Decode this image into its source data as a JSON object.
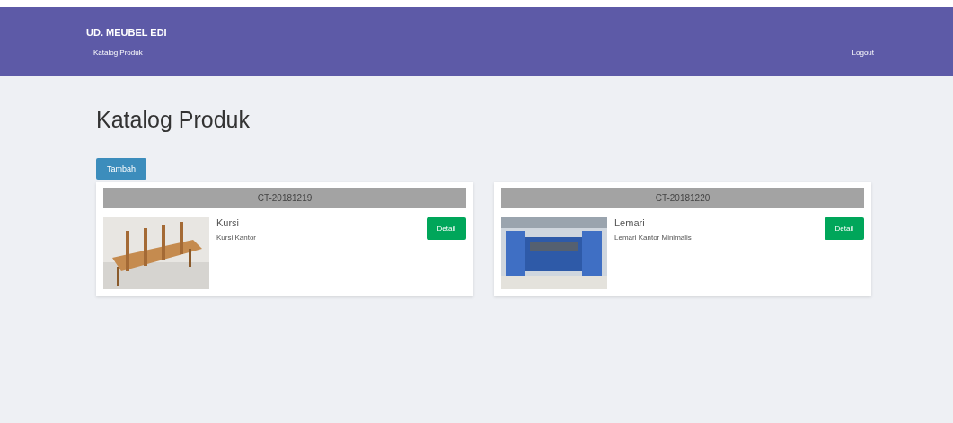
{
  "navbar": {
    "brand": "UD. MEUBEL EDI",
    "menu": [
      "Katalog Produk"
    ],
    "logout": "Logout"
  },
  "page_title": "Katalog Produk",
  "add_button": "Tambah",
  "products": [
    {
      "code": "CT-20181219",
      "name": "Kursi",
      "description": "Kursi Kantor",
      "button": "Detail"
    },
    {
      "code": "CT-20181220",
      "name": "Lemari",
      "description": "Lemari Kantor Minimalis",
      "button": "Detail"
    }
  ]
}
